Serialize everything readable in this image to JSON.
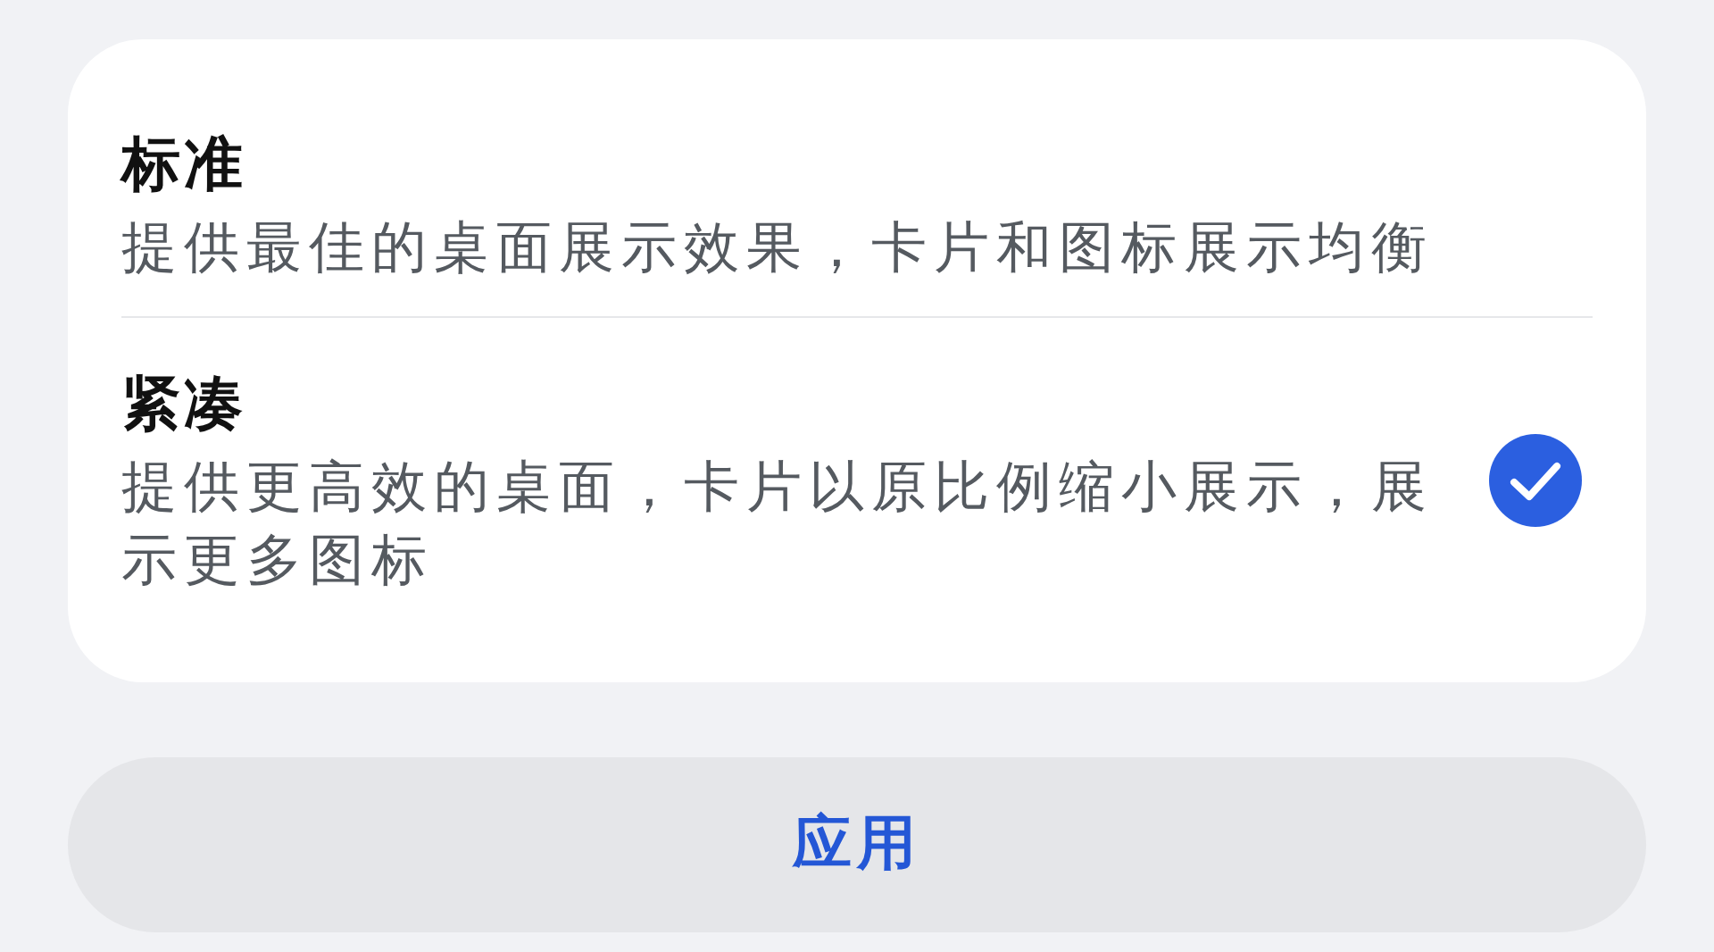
{
  "options": [
    {
      "title": "标准",
      "description": "提供最佳的桌面展示效果，卡片和图标展示均衡",
      "selected": false
    },
    {
      "title": "紧凑",
      "description": "提供更高效的桌面，卡片以原比例缩小展示，展示更多图标",
      "selected": true
    }
  ],
  "apply_button": {
    "label": "应用"
  }
}
